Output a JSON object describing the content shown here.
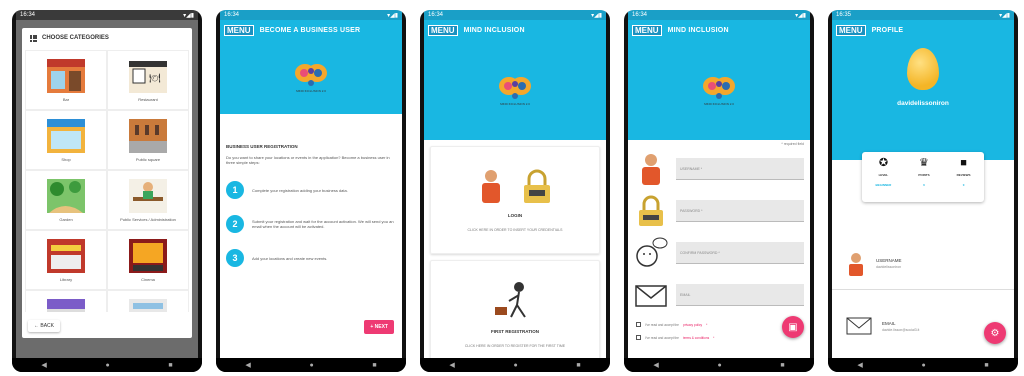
{
  "colors": {
    "primary": "#19b7e2",
    "accent": "#ee3a73",
    "dark_overlay": "#6c6c6c"
  },
  "status": {
    "time1": "16:34",
    "time5": "16:35"
  },
  "menu_label": "MENU",
  "screen1": {
    "title": "CHOOSE CATEGORIES",
    "categories": [
      "Bar",
      "Restaurant",
      "Shop",
      "Public square",
      "Garden",
      "Public Services / Administration",
      "Library",
      "Cinema"
    ],
    "back": "BACK"
  },
  "screen2": {
    "title": "BECOME A BUSINESS USER",
    "section": "BUSINESS USER REGISTRATION",
    "intro": "Do you want to share your locations or events in the application? Become a business user in three simple steps:",
    "steps": [
      {
        "num": "1",
        "text": "Complete your registration adding your business data."
      },
      {
        "num": "2",
        "text": "Submit your registration and wait for the account activation. We will send you an email when the account will be activated."
      },
      {
        "num": "3",
        "text": "Add your locations and create new events."
      }
    ],
    "next": "+ NEXT"
  },
  "screen3": {
    "title": "MIND INCLUSION",
    "logo_text": "MIND INCLUSION 2.0",
    "login_title": "LOGIN",
    "login_sub": "CLICK HERE IN ORDER TO INSERT YOUR CREDENTIALS",
    "reg_title": "FIRST REGISTRATION",
    "reg_sub": "CLICK HERE IN ORDER TO REGISTER FOR THE FIRST TIME"
  },
  "screen4": {
    "title": "MIND INCLUSION",
    "required": "* required field",
    "fields": [
      "USERNAME *",
      "PASSWORD *",
      "CONFIRM PASSWORD *",
      "EMAIL"
    ],
    "privacy_pre": "I've read and accept the ",
    "privacy_link": "privacy policy",
    "terms_pre": "I've read and accept the ",
    "terms_link": "terms & conditions",
    "req_mark": " *"
  },
  "screen5": {
    "title": "PROFILE",
    "username": "davidelissoniron",
    "stats": [
      {
        "label": "LEVEL",
        "value": "BEGINNER",
        "icon": "medal-icon"
      },
      {
        "label": "POINTS",
        "value": "0",
        "icon": "trophy-icon"
      },
      {
        "label": "REVIEWS",
        "value": "0",
        "icon": "chat-icon"
      }
    ],
    "username_label": "USERNAME",
    "username_value": "davidelissoniron",
    "email_label": "EMAIL",
    "email_value": "davide.lisson@social3.it"
  }
}
